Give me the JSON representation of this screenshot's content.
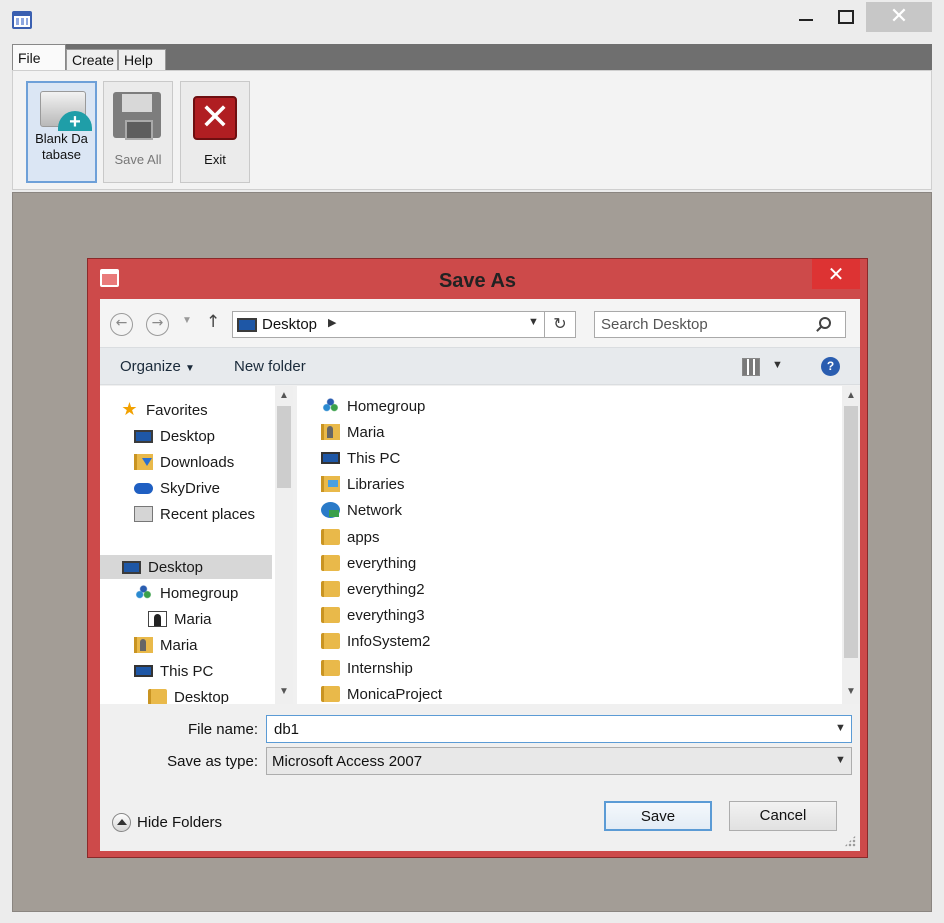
{
  "app": {
    "tabs": [
      {
        "label": "File"
      },
      {
        "label": "Create"
      },
      {
        "label": "Help"
      }
    ],
    "ribbon": {
      "blank_database": "Blank Database",
      "save_all": "Save All",
      "exit": "Exit"
    }
  },
  "dialog": {
    "title": "Save As",
    "address": "Desktop",
    "search_placeholder": "Search Desktop",
    "toolbar": {
      "organize": "Organize",
      "new_folder": "New folder"
    },
    "nav_tree": [
      {
        "label": "Favorites",
        "icon": "star-icon"
      },
      {
        "label": "Desktop",
        "icon": "desktop-icon"
      },
      {
        "label": "Downloads",
        "icon": "downloads-icon"
      },
      {
        "label": "SkyDrive",
        "icon": "skydrive-icon"
      },
      {
        "label": "Recent places",
        "icon": "recent-places-icon"
      },
      {
        "label": "Desktop",
        "icon": "desktop-icon",
        "selected": true
      },
      {
        "label": "Homegroup",
        "icon": "homegroup-icon"
      },
      {
        "label": "Maria",
        "icon": "user-icon"
      },
      {
        "label": "Maria",
        "icon": "user-folder-icon"
      },
      {
        "label": "This PC",
        "icon": "pc-icon"
      },
      {
        "label": "Desktop",
        "icon": "folder-icon"
      }
    ],
    "files": [
      {
        "name": "Homegroup",
        "icon": "homegroup-icon"
      },
      {
        "name": "Maria",
        "icon": "user-folder-icon"
      },
      {
        "name": "This PC",
        "icon": "pc-icon"
      },
      {
        "name": "Libraries",
        "icon": "libraries-icon"
      },
      {
        "name": "Network",
        "icon": "network-icon"
      },
      {
        "name": "apps",
        "icon": "folder-icon"
      },
      {
        "name": "everything",
        "icon": "folder-icon"
      },
      {
        "name": "everything2",
        "icon": "folder-icon"
      },
      {
        "name": "everything3",
        "icon": "folder-icon"
      },
      {
        "name": "InfoSystem2",
        "icon": "folder-icon"
      },
      {
        "name": "Internship",
        "icon": "folder-icon"
      },
      {
        "name": "MonicaProject",
        "icon": "folder-icon"
      }
    ],
    "filename_label": "File name:",
    "filename_value": "db1",
    "savetype_label": "Save as type:",
    "savetype_value": "Microsoft Access 2007",
    "hide_folders": "Hide Folders",
    "save": "Save",
    "cancel": "Cancel"
  }
}
